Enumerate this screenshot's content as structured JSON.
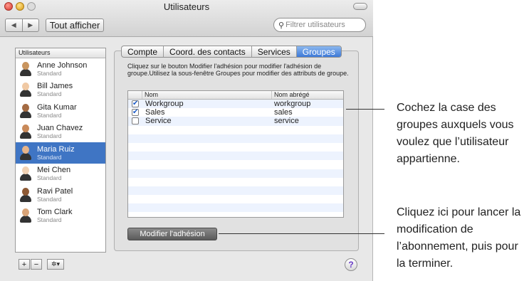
{
  "window": {
    "title": "Utilisateurs",
    "nav_back": "◀",
    "nav_forward": "▶",
    "show_all": "Tout afficher",
    "search_placeholder": "Filtrer utilisateurs",
    "search_icon": "magnifier-icon"
  },
  "userlist": {
    "header": "Utilisateurs",
    "users": [
      {
        "name": "Anne Johnson",
        "role": "Standard",
        "skin": "#c9955f"
      },
      {
        "name": "Bill James",
        "role": "Standard",
        "skin": "#f0c9a4"
      },
      {
        "name": "Gita Kumar",
        "role": "Standard",
        "skin": "#a46b43"
      },
      {
        "name": "Juan Chavez",
        "role": "Standard",
        "skin": "#c98a5a"
      },
      {
        "name": "Maria Ruiz",
        "role": "Standard",
        "skin": "#e6b48a"
      },
      {
        "name": "Mei Chen",
        "role": "Standard",
        "skin": "#f1d2b5"
      },
      {
        "name": "Ravi Patel",
        "role": "Standard",
        "skin": "#8e5a35"
      },
      {
        "name": "Tom Clark",
        "role": "Standard",
        "skin": "#d9a478"
      }
    ],
    "selected_index": 4,
    "add_label": "+",
    "remove_label": "−",
    "action_label": "✲▾"
  },
  "tabs": [
    "Compte",
    "Coord. des contacts",
    "Services",
    "Groupes"
  ],
  "active_tab": 3,
  "description": "Cliquez sur le bouton Modifier l'adhésion pour modifier l'adhésion de groupe.Utilisez la sous-fenêtre Groupes pour modifier des attributs de groupe.",
  "groups_table": {
    "columns": [
      "Nom",
      "Nom abrégé"
    ],
    "rows": [
      {
        "checked": true,
        "name": "Workgroup",
        "short": "workgroup"
      },
      {
        "checked": true,
        "name": "Sales",
        "short": "sales"
      },
      {
        "checked": false,
        "name": "Service",
        "short": "service"
      }
    ],
    "empty_rows": 11
  },
  "modify_button": "Modifier l'adhésion",
  "help_label": "?",
  "callouts": {
    "checkbox_note": "Cochez la case des groupes auxquels vous voulez que l’utilisateur appartienne.",
    "button_note": "Cliquez ici pour lancer la modification de l’abonnement, puis pour la terminer."
  }
}
